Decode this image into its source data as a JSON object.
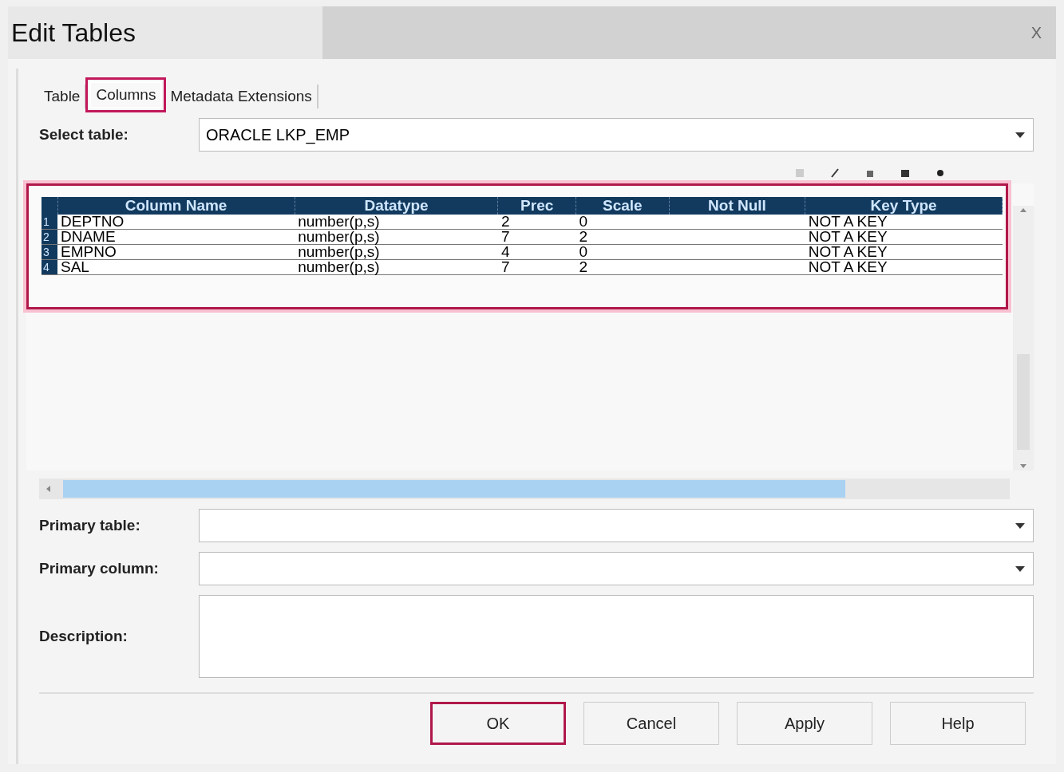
{
  "window": {
    "title": "Edit Tables",
    "close": "X"
  },
  "tabs": [
    {
      "label": "Table",
      "selected": false,
      "highlighted": false
    },
    {
      "label": "Columns",
      "selected": true,
      "highlighted": true
    },
    {
      "label": "Metadata Extensions",
      "selected": false,
      "highlighted": false
    }
  ],
  "select_table": {
    "label": "Select table:",
    "value": "ORACLE LKP_EMP"
  },
  "grid": {
    "highlighted": true,
    "columns": [
      "Column Name",
      "Datatype",
      "Prec",
      "Scale",
      "Not Null",
      "Key Type"
    ],
    "rows": [
      {
        "number": "1",
        "cells": [
          "DEPTNO",
          "number(p,s)",
          "2",
          "0",
          "",
          "NOT A KEY"
        ]
      },
      {
        "number": "2",
        "cells": [
          "DNAME",
          "number(p,s)",
          "7",
          "2",
          "",
          "NOT A KEY"
        ]
      },
      {
        "number": "3",
        "cells": [
          "EMPNO",
          "number(p,s)",
          "4",
          "0",
          "",
          "NOT A KEY"
        ]
      },
      {
        "number": "4",
        "cells": [
          "SAL",
          "number(p,s)",
          "7",
          "2",
          "",
          "NOT A KEY"
        ]
      }
    ]
  },
  "fields": [
    {
      "label": "Primary table:",
      "kind": "dropdown"
    },
    {
      "label": "Primary column:",
      "kind": "dropdown"
    },
    {
      "label": "Description:",
      "kind": "textarea"
    }
  ],
  "buttons": [
    {
      "label": "OK",
      "highlighted": true
    },
    {
      "label": "Cancel",
      "highlighted": false
    },
    {
      "label": "Apply",
      "highlighted": false
    },
    {
      "label": "Help",
      "highlighted": false
    }
  ]
}
